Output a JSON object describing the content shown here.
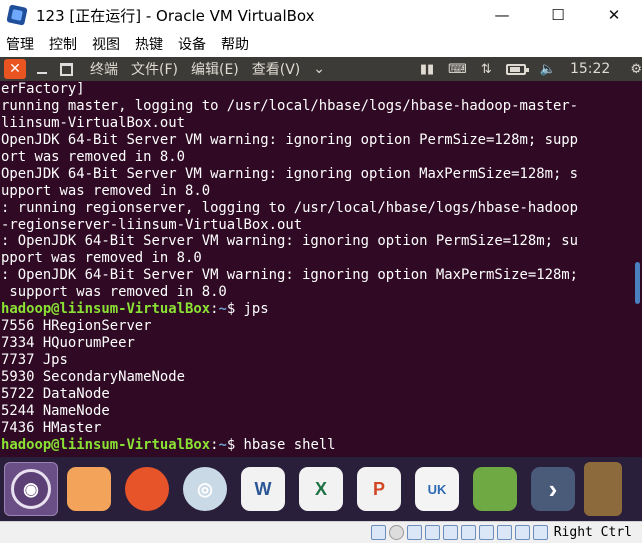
{
  "window": {
    "title": "123 [正在运行] - Oracle VM VirtualBox",
    "minimize": "—",
    "maximize": "☐",
    "close": "✕"
  },
  "vbox_menu": [
    "管理",
    "控制",
    "视图",
    "热键",
    "设备",
    "帮助"
  ],
  "terminal_panel": {
    "close": "✕",
    "menus": [
      "终端",
      "文件(F)",
      "编辑(E)",
      "查看(V)"
    ],
    "menu_overflow": "⌄",
    "clock": "15:22"
  },
  "terminal_lines": [
    [
      {
        "t": "erFactory]",
        "c": ""
      }
    ],
    [
      {
        "t": "running master, logging to /usr/local/hbase/logs/hbase-hadoop-master-",
        "c": ""
      }
    ],
    [
      {
        "t": "liinsum-VirtualBox.out",
        "c": ""
      }
    ],
    [
      {
        "t": "OpenJDK 64-Bit Server VM warning: ignoring option PermSize=128m; supp",
        "c": ""
      }
    ],
    [
      {
        "t": "ort was removed in 8.0",
        "c": ""
      }
    ],
    [
      {
        "t": "OpenJDK 64-Bit Server VM warning: ignoring option MaxPermSize=128m; s",
        "c": ""
      }
    ],
    [
      {
        "t": "upport was removed in 8.0",
        "c": ""
      }
    ],
    [
      {
        "t": ": running regionserver, logging to /usr/local/hbase/logs/hbase-hadoop",
        "c": ""
      }
    ],
    [
      {
        "t": "-regionserver-liinsum-VirtualBox.out",
        "c": ""
      }
    ],
    [
      {
        "t": ": OpenJDK 64-Bit Server VM warning: ignoring option PermSize=128m; su",
        "c": ""
      }
    ],
    [
      {
        "t": "pport was removed in 8.0",
        "c": ""
      }
    ],
    [
      {
        "t": ": OpenJDK 64-Bit Server VM warning: ignoring option MaxPermSize=128m;",
        "c": ""
      }
    ],
    [
      {
        "t": " support was removed in 8.0",
        "c": ""
      }
    ],
    [
      {
        "t": "hadoop@liinsum-VirtualBox",
        "c": "prompt-user"
      },
      {
        "t": ":",
        "c": ""
      },
      {
        "t": "~",
        "c": "prompt-path"
      },
      {
        "t": "$ jps",
        "c": ""
      }
    ],
    [
      {
        "t": "7556 HRegionServer",
        "c": ""
      }
    ],
    [
      {
        "t": "7334 HQuorumPeer",
        "c": ""
      }
    ],
    [
      {
        "t": "7737 Jps",
        "c": ""
      }
    ],
    [
      {
        "t": "5930 SecondaryNameNode",
        "c": ""
      }
    ],
    [
      {
        "t": "5722 DataNode",
        "c": ""
      }
    ],
    [
      {
        "t": "5244 NameNode",
        "c": ""
      }
    ],
    [
      {
        "t": "7436 HMaster",
        "c": ""
      }
    ],
    [
      {
        "t": "hadoop@liinsum-VirtualBox",
        "c": "prompt-user"
      },
      {
        "t": ":",
        "c": ""
      },
      {
        "t": "~",
        "c": "prompt-path"
      },
      {
        "t": "$ hbase shell",
        "c": ""
      }
    ]
  ],
  "dock": [
    {
      "name": "dock-ubuntu-icon",
      "glyph": "◉",
      "cls": "d-ubuntu"
    },
    {
      "name": "dock-files-icon",
      "glyph": "",
      "cls": "d-files"
    },
    {
      "name": "dock-firefox-icon",
      "glyph": "",
      "cls": "d-firefox"
    },
    {
      "name": "dock-chromium-icon",
      "glyph": "◎",
      "cls": "d-chrome"
    },
    {
      "name": "dock-word-icon",
      "glyph": "W",
      "cls": "d-word"
    },
    {
      "name": "dock-excel-icon",
      "glyph": "X",
      "cls": "d-excel"
    },
    {
      "name": "dock-powerpoint-icon",
      "glyph": "P",
      "cls": "d-ppt"
    },
    {
      "name": "dock-store-icon",
      "glyph": "UK",
      "cls": "d-store"
    },
    {
      "name": "dock-software-icon",
      "glyph": "",
      "cls": "d-sw"
    },
    {
      "name": "dock-more-icon",
      "glyph": "›",
      "cls": "d-more"
    }
  ],
  "statusbar": {
    "host_key": "Right Ctrl"
  },
  "colors": {
    "terminal_bg": "#300a24",
    "prompt_user": "#8ae234",
    "prompt_path": "#729fcf",
    "ubuntu_orange": "#e95420"
  }
}
